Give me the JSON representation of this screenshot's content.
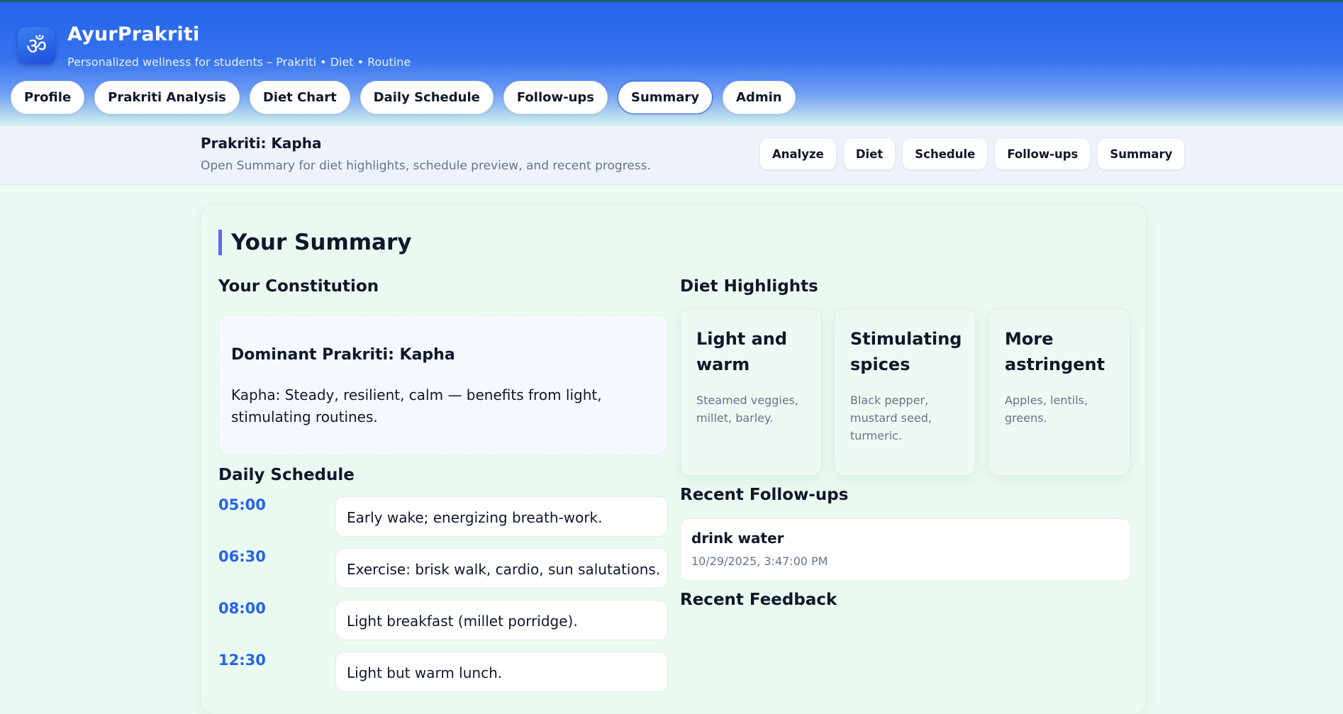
{
  "app": {
    "logo_glyph": "ॐ",
    "title": "AyurPrakriti",
    "subtitle": "Personalized wellness for students – Prakriti • Diet • Routine"
  },
  "nav": {
    "items": [
      {
        "label": "Profile",
        "active": false
      },
      {
        "label": "Prakriti Analysis",
        "active": false
      },
      {
        "label": "Diet Chart",
        "active": false
      },
      {
        "label": "Daily Schedule",
        "active": false
      },
      {
        "label": "Follow-ups",
        "active": false
      },
      {
        "label": "Summary",
        "active": true
      },
      {
        "label": "Admin",
        "active": false
      }
    ]
  },
  "strip": {
    "title": "Prakriti: Kapha",
    "subtitle": "Open Summary for diet highlights, schedule preview, and recent progress.",
    "quick_links": [
      "Analyze",
      "Diet",
      "Schedule",
      "Follow-ups",
      "Summary"
    ]
  },
  "summary": {
    "title": "Your Summary",
    "constitution": {
      "heading": "Your Constitution",
      "dominant": "Dominant Prakriti: Kapha",
      "description": "Kapha: Steady, resilient, calm — benefits from light, stimulating routines."
    },
    "schedule": {
      "heading": "Daily Schedule",
      "items": [
        {
          "time": "05:00",
          "activity": "Early wake; energizing breath-work."
        },
        {
          "time": "06:30",
          "activity": "Exercise: brisk walk, cardio, sun salutations."
        },
        {
          "time": "08:00",
          "activity": "Light breakfast (millet porridge)."
        },
        {
          "time": "12:30",
          "activity": "Light but warm lunch."
        }
      ]
    },
    "diet": {
      "heading": "Diet Highlights",
      "cards": [
        {
          "name": "Light and warm",
          "items": "Steamed veggies, millet, barley."
        },
        {
          "name": "Stimulating spices",
          "items": "Black pepper, mustard seed, turmeric."
        },
        {
          "name": "More astringent",
          "items": "Apples, lentils, greens."
        }
      ]
    },
    "followups": {
      "heading": "Recent Follow-ups",
      "items": [
        {
          "name": "drink water",
          "date": "10/29/2025, 3:47:00 PM"
        }
      ]
    },
    "feedback": {
      "heading": "Recent Feedback"
    }
  },
  "colors": {
    "accent": "#2563eb",
    "title_bar": "#6366f1"
  }
}
